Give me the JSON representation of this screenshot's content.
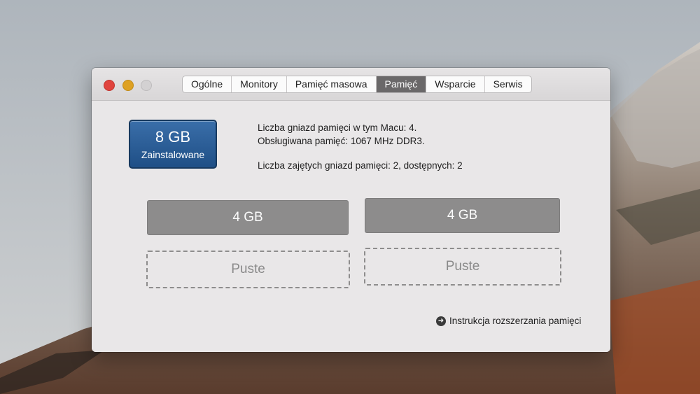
{
  "window": {
    "tabs": [
      {
        "label": "Ogólne",
        "active": false
      },
      {
        "label": "Monitory",
        "active": false
      },
      {
        "label": "Pamięć masowa",
        "active": false
      },
      {
        "label": "Pamięć",
        "active": true
      },
      {
        "label": "Wsparcie",
        "active": false
      },
      {
        "label": "Serwis",
        "active": false
      }
    ]
  },
  "memory": {
    "badge_size": "8 GB",
    "badge_label": "Zainstalowane",
    "info_slots": "Liczba gniazd pamięci w tym Macu: 4.",
    "info_supported": "Obsługiwana pamięć: 1067 MHz DDR3.",
    "info_usage": "Liczba zajętych gniazd pamięci: 2, dostępnych: 2",
    "slots": [
      {
        "label": "4  GB",
        "state": "full"
      },
      {
        "label": "4  GB",
        "state": "full"
      },
      {
        "label": "Puste",
        "state": "empty"
      },
      {
        "label": "Puste",
        "state": "empty"
      }
    ],
    "upgrade_link": "Instrukcja rozszerzania pamięci"
  },
  "colors": {
    "active_tab": "#6a6869",
    "badge": "#2c5e98",
    "slot_full": "#8d8c8c"
  },
  "icons": {
    "upgrade_link_icon": "arrow-right-circle-icon"
  }
}
